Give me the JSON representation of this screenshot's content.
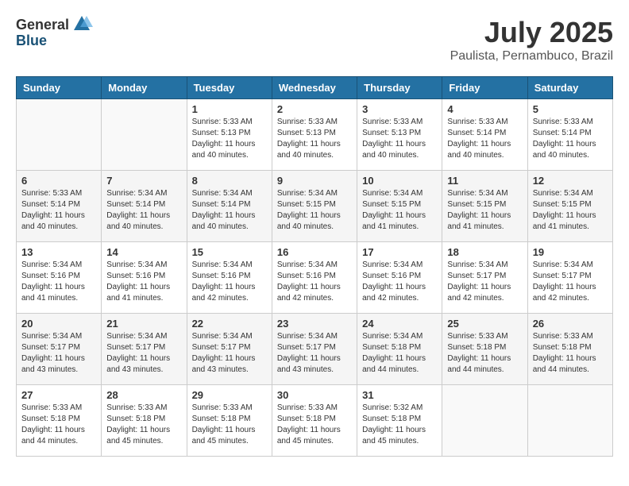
{
  "header": {
    "logo_general": "General",
    "logo_blue": "Blue",
    "month": "July 2025",
    "location": "Paulista, Pernambuco, Brazil"
  },
  "days_of_week": [
    "Sunday",
    "Monday",
    "Tuesday",
    "Wednesday",
    "Thursday",
    "Friday",
    "Saturday"
  ],
  "weeks": [
    [
      {
        "day": "",
        "info": ""
      },
      {
        "day": "",
        "info": ""
      },
      {
        "day": "1",
        "info": "Sunrise: 5:33 AM\nSunset: 5:13 PM\nDaylight: 11 hours and 40 minutes."
      },
      {
        "day": "2",
        "info": "Sunrise: 5:33 AM\nSunset: 5:13 PM\nDaylight: 11 hours and 40 minutes."
      },
      {
        "day": "3",
        "info": "Sunrise: 5:33 AM\nSunset: 5:13 PM\nDaylight: 11 hours and 40 minutes."
      },
      {
        "day": "4",
        "info": "Sunrise: 5:33 AM\nSunset: 5:14 PM\nDaylight: 11 hours and 40 minutes."
      },
      {
        "day": "5",
        "info": "Sunrise: 5:33 AM\nSunset: 5:14 PM\nDaylight: 11 hours and 40 minutes."
      }
    ],
    [
      {
        "day": "6",
        "info": "Sunrise: 5:33 AM\nSunset: 5:14 PM\nDaylight: 11 hours and 40 minutes."
      },
      {
        "day": "7",
        "info": "Sunrise: 5:34 AM\nSunset: 5:14 PM\nDaylight: 11 hours and 40 minutes."
      },
      {
        "day": "8",
        "info": "Sunrise: 5:34 AM\nSunset: 5:14 PM\nDaylight: 11 hours and 40 minutes."
      },
      {
        "day": "9",
        "info": "Sunrise: 5:34 AM\nSunset: 5:15 PM\nDaylight: 11 hours and 40 minutes."
      },
      {
        "day": "10",
        "info": "Sunrise: 5:34 AM\nSunset: 5:15 PM\nDaylight: 11 hours and 41 minutes."
      },
      {
        "day": "11",
        "info": "Sunrise: 5:34 AM\nSunset: 5:15 PM\nDaylight: 11 hours and 41 minutes."
      },
      {
        "day": "12",
        "info": "Sunrise: 5:34 AM\nSunset: 5:15 PM\nDaylight: 11 hours and 41 minutes."
      }
    ],
    [
      {
        "day": "13",
        "info": "Sunrise: 5:34 AM\nSunset: 5:16 PM\nDaylight: 11 hours and 41 minutes."
      },
      {
        "day": "14",
        "info": "Sunrise: 5:34 AM\nSunset: 5:16 PM\nDaylight: 11 hours and 41 minutes."
      },
      {
        "day": "15",
        "info": "Sunrise: 5:34 AM\nSunset: 5:16 PM\nDaylight: 11 hours and 42 minutes."
      },
      {
        "day": "16",
        "info": "Sunrise: 5:34 AM\nSunset: 5:16 PM\nDaylight: 11 hours and 42 minutes."
      },
      {
        "day": "17",
        "info": "Sunrise: 5:34 AM\nSunset: 5:16 PM\nDaylight: 11 hours and 42 minutes."
      },
      {
        "day": "18",
        "info": "Sunrise: 5:34 AM\nSunset: 5:17 PM\nDaylight: 11 hours and 42 minutes."
      },
      {
        "day": "19",
        "info": "Sunrise: 5:34 AM\nSunset: 5:17 PM\nDaylight: 11 hours and 42 minutes."
      }
    ],
    [
      {
        "day": "20",
        "info": "Sunrise: 5:34 AM\nSunset: 5:17 PM\nDaylight: 11 hours and 43 minutes."
      },
      {
        "day": "21",
        "info": "Sunrise: 5:34 AM\nSunset: 5:17 PM\nDaylight: 11 hours and 43 minutes."
      },
      {
        "day": "22",
        "info": "Sunrise: 5:34 AM\nSunset: 5:17 PM\nDaylight: 11 hours and 43 minutes."
      },
      {
        "day": "23",
        "info": "Sunrise: 5:34 AM\nSunset: 5:17 PM\nDaylight: 11 hours and 43 minutes."
      },
      {
        "day": "24",
        "info": "Sunrise: 5:34 AM\nSunset: 5:18 PM\nDaylight: 11 hours and 44 minutes."
      },
      {
        "day": "25",
        "info": "Sunrise: 5:33 AM\nSunset: 5:18 PM\nDaylight: 11 hours and 44 minutes."
      },
      {
        "day": "26",
        "info": "Sunrise: 5:33 AM\nSunset: 5:18 PM\nDaylight: 11 hours and 44 minutes."
      }
    ],
    [
      {
        "day": "27",
        "info": "Sunrise: 5:33 AM\nSunset: 5:18 PM\nDaylight: 11 hours and 44 minutes."
      },
      {
        "day": "28",
        "info": "Sunrise: 5:33 AM\nSunset: 5:18 PM\nDaylight: 11 hours and 45 minutes."
      },
      {
        "day": "29",
        "info": "Sunrise: 5:33 AM\nSunset: 5:18 PM\nDaylight: 11 hours and 45 minutes."
      },
      {
        "day": "30",
        "info": "Sunrise: 5:33 AM\nSunset: 5:18 PM\nDaylight: 11 hours and 45 minutes."
      },
      {
        "day": "31",
        "info": "Sunrise: 5:32 AM\nSunset: 5:18 PM\nDaylight: 11 hours and 45 minutes."
      },
      {
        "day": "",
        "info": ""
      },
      {
        "day": "",
        "info": ""
      }
    ]
  ]
}
